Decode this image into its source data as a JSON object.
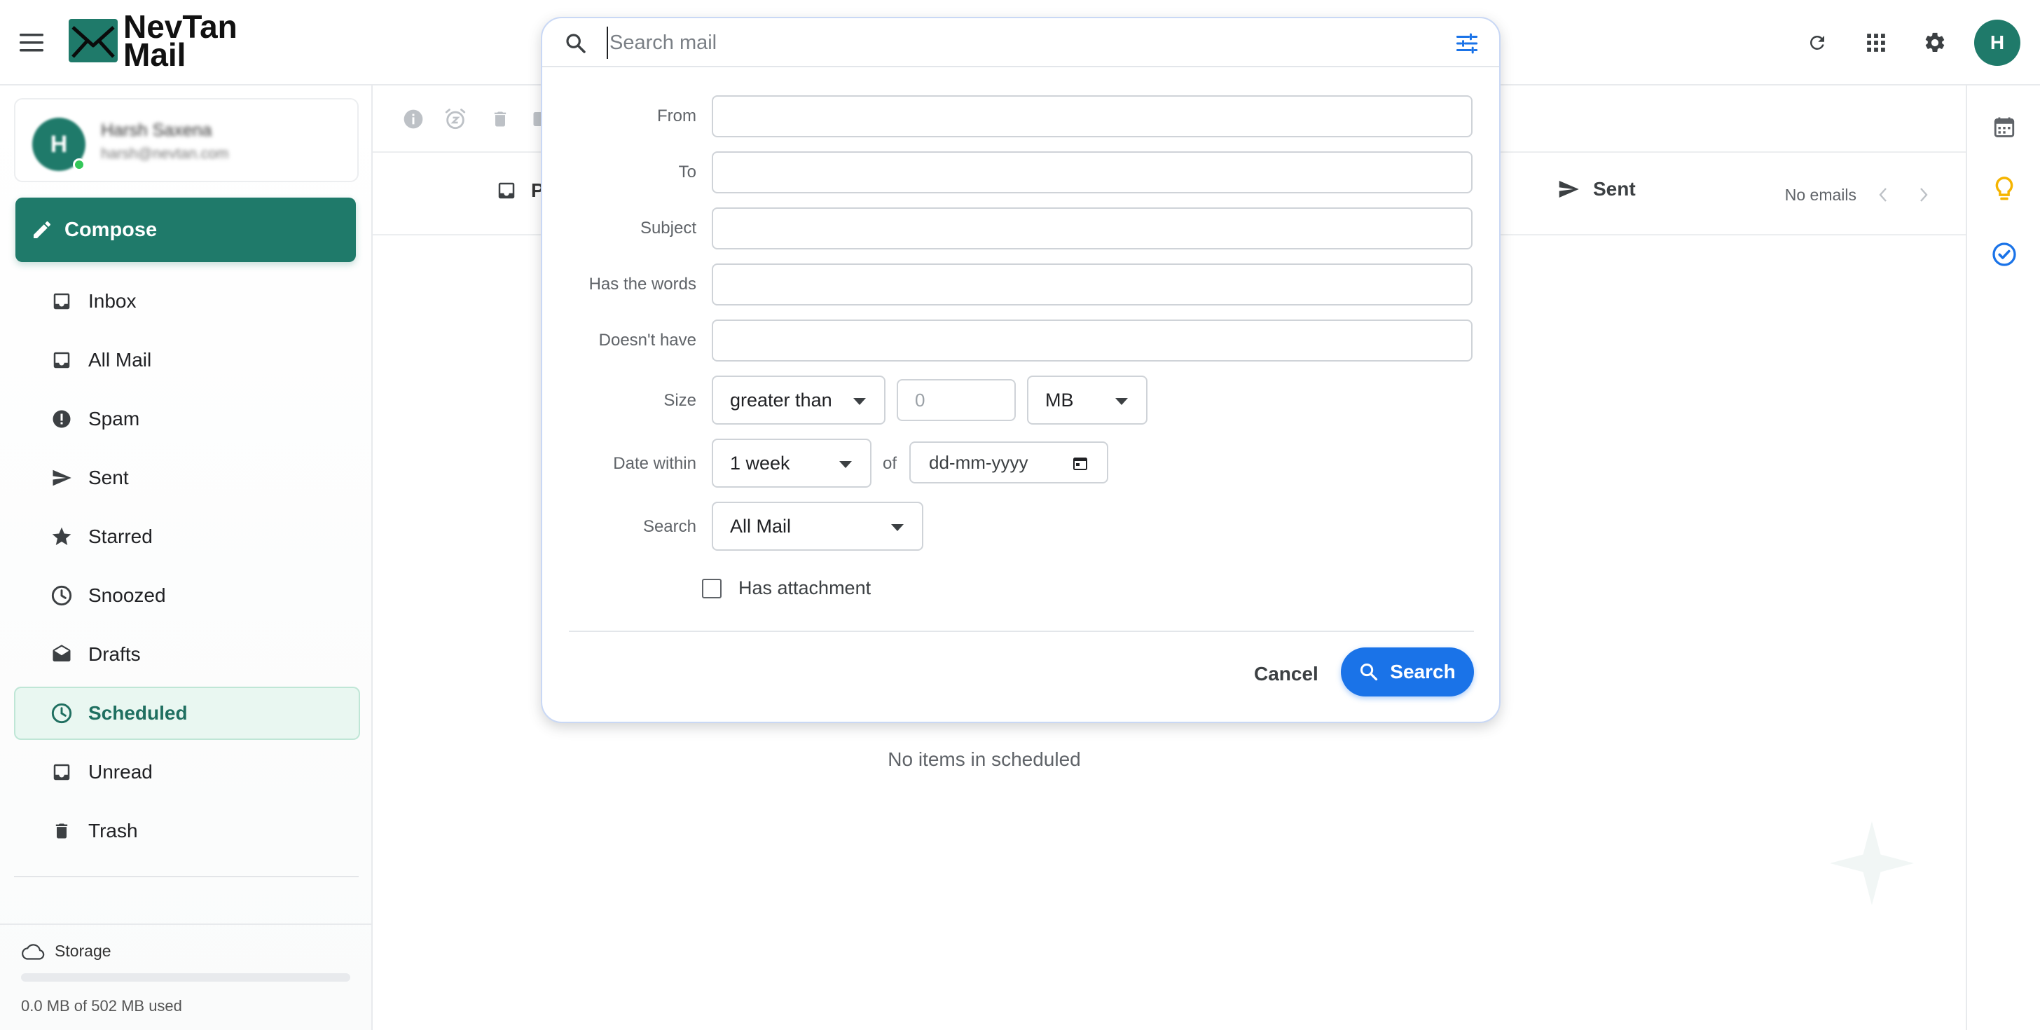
{
  "app": {
    "logo_line1": "NevTan",
    "logo_line2": "Mail"
  },
  "colors": {
    "brand": "#1f7a6a",
    "accent_blue": "#1a73e8",
    "active_bg": "#e9f7f1"
  },
  "account": {
    "initial": "H",
    "name": "Harsh Saxena",
    "email": "harsh@nevtan.com"
  },
  "header": {
    "avatar_initial": "H",
    "icons": [
      "refresh-icon",
      "apps-grid-icon",
      "settings-gear-icon"
    ]
  },
  "sidebar": {
    "compose_label": "Compose",
    "items": [
      {
        "label": "Inbox",
        "icon": "inbox-icon"
      },
      {
        "label": "All Mail",
        "icon": "all-mail-icon"
      },
      {
        "label": "Spam",
        "icon": "spam-icon"
      },
      {
        "label": "Sent",
        "icon": "sent-icon"
      },
      {
        "label": "Starred",
        "icon": "star-icon"
      },
      {
        "label": "Snoozed",
        "icon": "clock-icon"
      },
      {
        "label": "Drafts",
        "icon": "drafts-icon"
      },
      {
        "label": "Scheduled",
        "icon": "scheduled-icon",
        "active": true
      },
      {
        "label": "Unread",
        "icon": "unread-icon"
      },
      {
        "label": "Trash",
        "icon": "trash-icon"
      }
    ]
  },
  "storage": {
    "title": "Storage",
    "used_text": "0.0 MB of 502 MB used",
    "fraction": 0.0
  },
  "main": {
    "tab_primary_partial": "P",
    "tab_sent": "Sent",
    "pager_text": "No emails",
    "empty_text": "No items in scheduled"
  },
  "search": {
    "placeholder": "Search mail",
    "value": "",
    "labels": {
      "from": "From",
      "to": "To",
      "subject": "Subject",
      "has_words": "Has the words",
      "doesnt_have": "Doesn't have",
      "size": "Size",
      "date_within": "Date within",
      "of": "of",
      "search_in": "Search"
    },
    "size_operator": "greater than",
    "size_value_placeholder": "0",
    "size_unit": "MB",
    "date_range": "1 week",
    "date_placeholder": "dd-mm-yyyy",
    "search_scope": "All Mail",
    "has_attachment_label": "Has attachment",
    "has_attachment_checked": false,
    "cancel_label": "Cancel",
    "submit_label": "Search"
  }
}
